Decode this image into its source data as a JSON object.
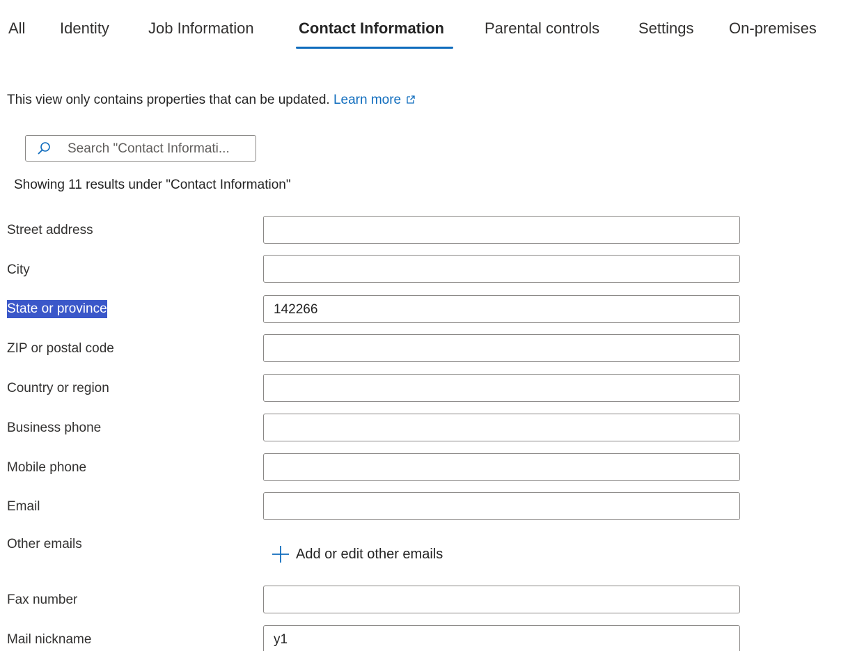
{
  "tabs": [
    {
      "label": "All"
    },
    {
      "label": "Identity"
    },
    {
      "label": "Job Information"
    },
    {
      "label": "Contact Information",
      "active": true
    },
    {
      "label": "Parental controls"
    },
    {
      "label": "Settings"
    },
    {
      "label": "On-premises"
    }
  ],
  "notice": {
    "text": "This view only contains properties that can be updated.",
    "link": "Learn more"
  },
  "search": {
    "placeholder": "Search \"Contact Informati..."
  },
  "results_text": "Showing 11 results under \"Contact Information\"",
  "fields": [
    {
      "label": "Street address",
      "value": ""
    },
    {
      "label": "City",
      "value": ""
    },
    {
      "label": "State or province",
      "value": "142266",
      "selected": true
    },
    {
      "label": "ZIP or postal code",
      "value": ""
    },
    {
      "label": "Country or region",
      "value": ""
    },
    {
      "label": "Business phone",
      "value": ""
    },
    {
      "label": "Mobile phone",
      "value": ""
    },
    {
      "label": "Email",
      "value": ""
    },
    {
      "label": "Other emails",
      "action": "Add or edit other emails"
    },
    {
      "label": "Fax number",
      "value": ""
    },
    {
      "label": "Mail nickname",
      "value": "y1"
    }
  ],
  "colors": {
    "accent": "#0f6cbd",
    "selection": "#3a57c9",
    "border": "#8a8886"
  }
}
